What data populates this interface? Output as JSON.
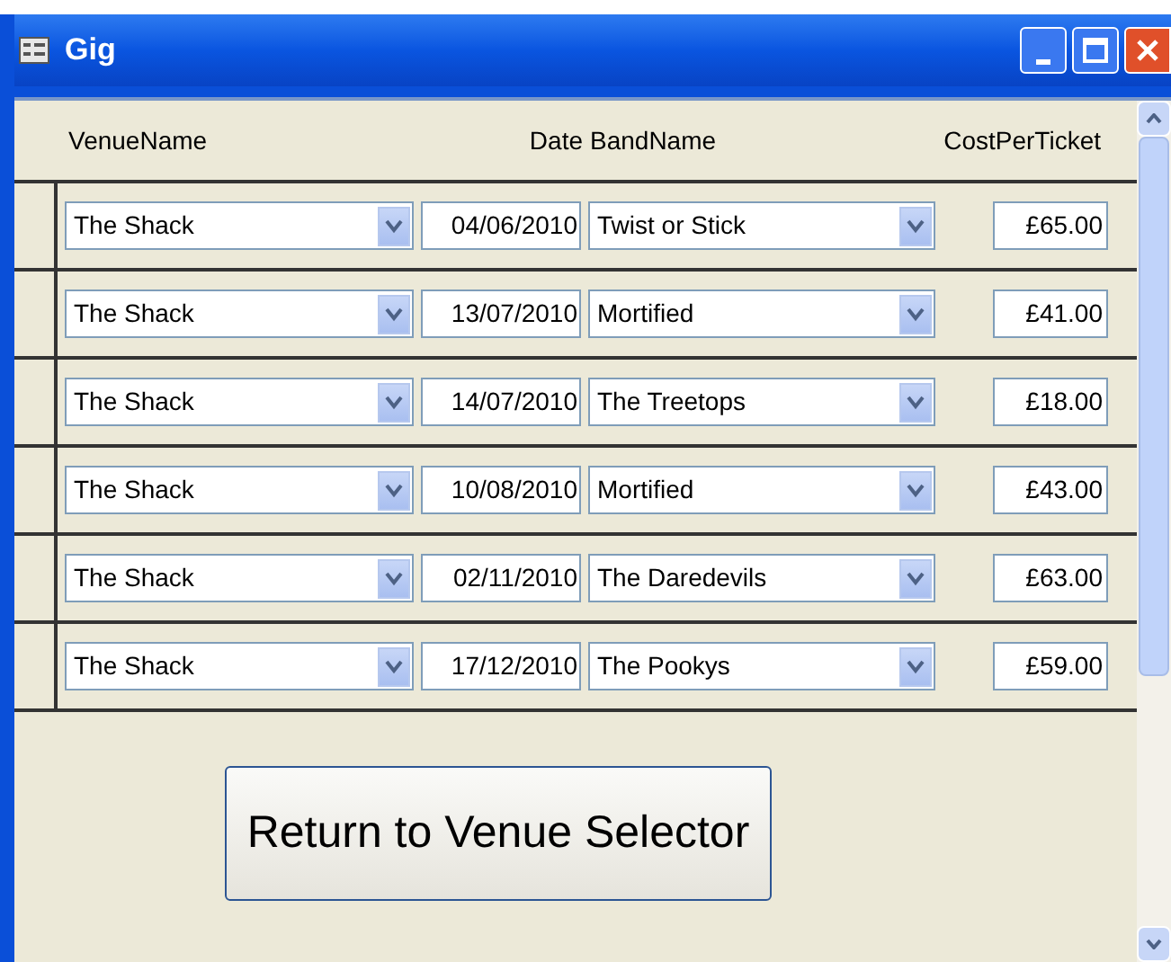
{
  "window": {
    "title": "Gig"
  },
  "table": {
    "columns": [
      "VenueName",
      "Date",
      "BandName",
      "CostPerTicket"
    ],
    "rows": [
      {
        "venue": "The Shack",
        "date": "04/06/2010",
        "band": "Twist or Stick",
        "cost": "£65.00"
      },
      {
        "venue": "The Shack",
        "date": "13/07/2010",
        "band": "Mortified",
        "cost": "£41.00"
      },
      {
        "venue": "The Shack",
        "date": "14/07/2010",
        "band": "The Treetops",
        "cost": "£18.00"
      },
      {
        "venue": "The Shack",
        "date": "10/08/2010",
        "band": "Mortified",
        "cost": "£43.00"
      },
      {
        "venue": "The Shack",
        "date": "02/11/2010",
        "band": "The Daredevils",
        "cost": "£63.00"
      },
      {
        "venue": "The Shack",
        "date": "17/12/2010",
        "band": "The Pookys",
        "cost": "£59.00"
      }
    ]
  },
  "button": {
    "label": "Return to Venue Selector"
  }
}
